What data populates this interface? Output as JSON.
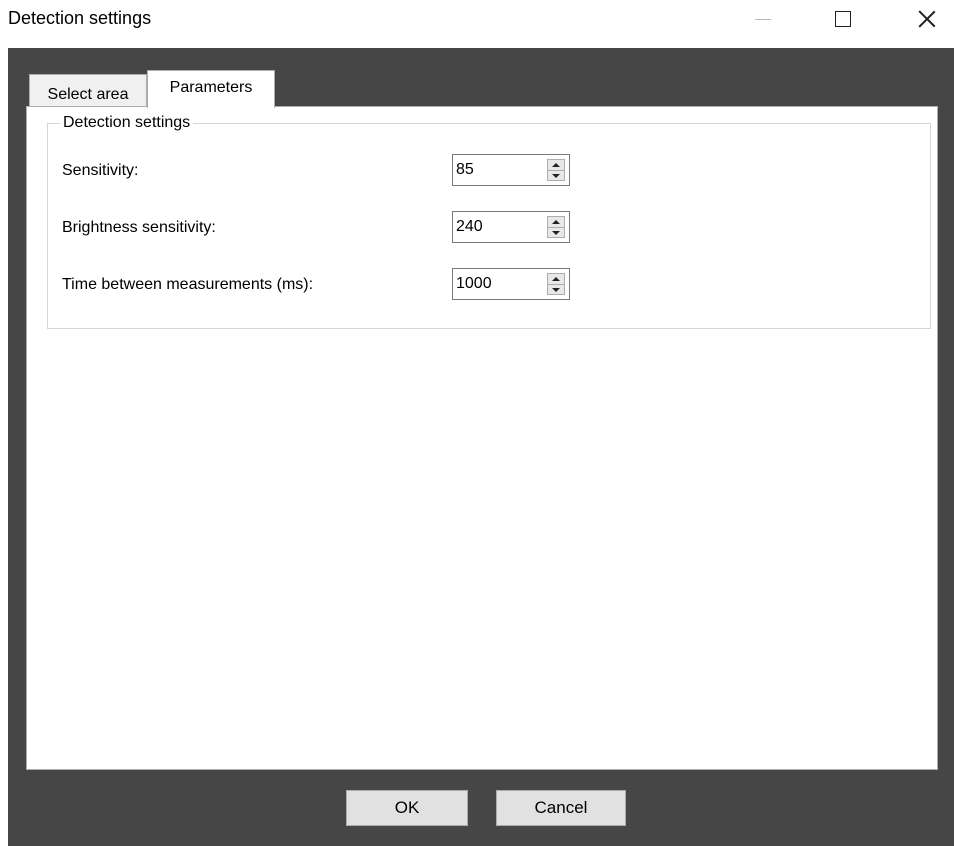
{
  "window": {
    "title": "Detection settings",
    "icons": {
      "minimize": "minimize-icon",
      "maximize": "maximize-icon",
      "close": "close-icon"
    }
  },
  "tabs": [
    {
      "label": "Select area",
      "selected": false
    },
    {
      "label": "Parameters",
      "selected": true
    }
  ],
  "group": {
    "legend": "Detection settings",
    "fields": [
      {
        "label": "Sensitivity:",
        "value": "85"
      },
      {
        "label": "Brightness sensitivity:",
        "value": "240"
      },
      {
        "label": "Time between measurements (ms):",
        "value": "1000"
      }
    ]
  },
  "buttons": {
    "ok": "OK",
    "cancel": "Cancel"
  }
}
